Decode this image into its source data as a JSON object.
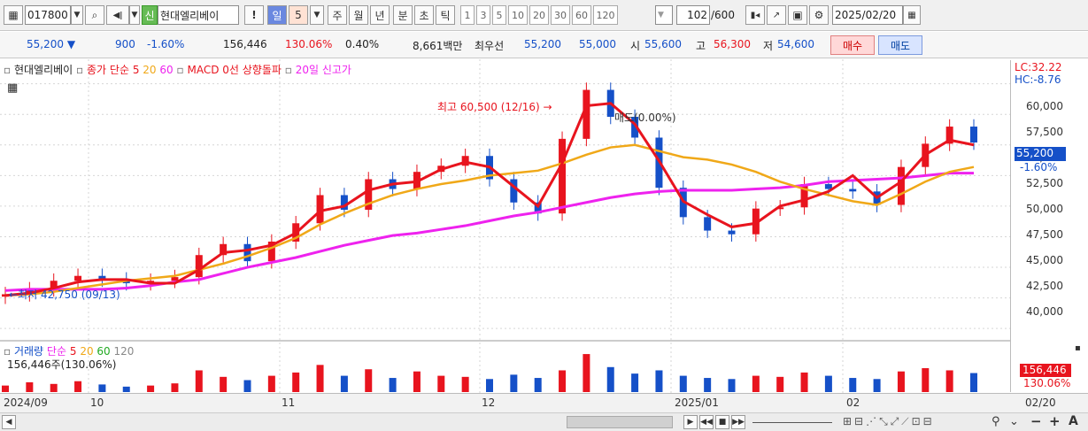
{
  "toolbar": {
    "code": "017800",
    "stock_name": "현대엘리베이",
    "tag": "신",
    "buttons": {
      "warn": "!",
      "day": "일",
      "unit": "5",
      "week": "주",
      "month": "월",
      "year": "년",
      "minute": "분",
      "second": "초",
      "tick": "틱"
    },
    "periods": [
      "1",
      "3",
      "5",
      "10",
      "20",
      "30",
      "60",
      "120"
    ],
    "count": "102",
    "count_total": "/600",
    "date": "2025/02/20"
  },
  "quote": {
    "price": "55,200",
    "change": "900",
    "change_pct": "-1.60%",
    "volume": "156,446",
    "volume_ratio": "130.06%",
    "turnover": "0.40%",
    "amount": "8,661백만",
    "best_label": "최우선",
    "best_ask": "55,200",
    "best_bid": "55,000",
    "open_label": "시",
    "open": "55,600",
    "high_label": "고",
    "high": "56,300",
    "low_label": "저",
    "low": "54,600",
    "buy_label": "매수",
    "sell_label": "매도"
  },
  "legend": {
    "name": "현대엘리베이",
    "close_ma": "종가 단순",
    "ma5": "5",
    "ma20": "20",
    "ma60": "60",
    "macd": "MACD 0선 상향돌파",
    "newhigh": "20일 신고가"
  },
  "corner": {
    "lc": "LC:32.22",
    "hc": "HC:-8.76"
  },
  "price_axis": [
    "60,000",
    "57,500",
    "55,000",
    "52,500",
    "50,000",
    "47,500",
    "45,000",
    "42,500",
    "40,000"
  ],
  "current_tag": {
    "price": "55,200",
    "pct": "-1.60%"
  },
  "annotations": {
    "high": "최고 60,500 (12/16) →",
    "low": "←최저 42,750 (09/13)",
    "signal": "매도(0.00%)"
  },
  "volume_panel": {
    "title": "거래량",
    "ma_label": "단순",
    "ma5": "5",
    "ma20": "20",
    "ma60": "60",
    "ma120": "120",
    "value": "156,446주(130.06%)",
    "tag_value": "156,446",
    "tag_pct": "130.06%"
  },
  "x_axis": [
    "2024/09",
    "10",
    "11",
    "12",
    "2025/01",
    "02",
    "02/20"
  ],
  "colors": {
    "up": "#e8141e",
    "down": "#1550c8",
    "ma5": "#e8141e",
    "ma20": "#f0a818",
    "ma60": "#ee22ee"
  },
  "chart_data": {
    "type": "candlestick",
    "ylim": [
      39000,
      62000
    ],
    "ma5": [
      42700,
      42900,
      43300,
      43800,
      44000,
      44000,
      43700,
      43700,
      44800,
      46200,
      46400,
      46800,
      47800,
      49600,
      50000,
      51300,
      51800,
      52000,
      53000,
      53600,
      53200,
      51600,
      50000,
      53500,
      58200,
      58400,
      56700,
      53700,
      50400,
      49300,
      48300,
      48600,
      50000,
      50500,
      51200,
      52500,
      50700,
      52000,
      54200,
      55400,
      55000
    ],
    "ma20": [
      42700,
      42800,
      43000,
      43300,
      43600,
      43900,
      44100,
      44300,
      44800,
      45300,
      45900,
      46600,
      47400,
      48500,
      49400,
      50200,
      50900,
      51400,
      51800,
      52100,
      52500,
      52700,
      52900,
      53500,
      54200,
      54800,
      55000,
      54500,
      54000,
      53800,
      53400,
      52800,
      52000,
      51400,
      50900,
      50400,
      50100,
      51000,
      52000,
      52800,
      53200
    ],
    "ma60": [
      43100,
      43200,
      43200,
      43200,
      43200,
      43300,
      43500,
      43800,
      44000,
      44500,
      45000,
      45400,
      45800,
      46300,
      46800,
      47200,
      47600,
      47800,
      48100,
      48400,
      48800,
      49200,
      49500,
      49900,
      50300,
      50700,
      51000,
      51200,
      51300,
      51300,
      51300,
      51400,
      51500,
      51700,
      52000,
      52100,
      52200,
      52300,
      52500,
      52700,
      52700
    ],
    "close": [
      42800,
      43200,
      43900,
      44300,
      44000,
      43700,
      43900,
      44200,
      46000,
      46900,
      45500,
      47100,
      48600,
      50900,
      49700,
      52200,
      51400,
      52800,
      53300,
      54100,
      52200,
      50300,
      49400,
      55500,
      59500,
      57300,
      55600,
      51500,
      49100,
      48000,
      47700,
      49800,
      49900,
      51800,
      51400,
      51200,
      50100,
      53200,
      55100,
      56500,
      55200
    ],
    "volume_max_label": "156,446",
    "volume": [
      12,
      18,
      15,
      20,
      14,
      10,
      12,
      16,
      40,
      28,
      22,
      30,
      36,
      50,
      30,
      42,
      26,
      38,
      30,
      28,
      24,
      32,
      26,
      40,
      70,
      46,
      34,
      40,
      30,
      26,
      24,
      30,
      28,
      36,
      30,
      26,
      24,
      38,
      44,
      40,
      35
    ]
  }
}
